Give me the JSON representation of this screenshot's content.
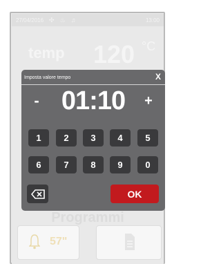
{
  "status_bar": {
    "date": "27/04/2016",
    "time": "13:00",
    "icons": [
      "fan-icon",
      "heating-icon",
      "bell-icon"
    ]
  },
  "main": {
    "temp_label": "temp",
    "temp_value": "120",
    "temp_unit": "°C",
    "program_label": "Programmi",
    "alarm_tile_value": "57\""
  },
  "dialog": {
    "title": "Imposta valore tempo",
    "close_label": "X",
    "minus_label": "-",
    "plus_label": "+",
    "time_value": "01:10",
    "keys": [
      "1",
      "2",
      "3",
      "4",
      "5",
      "6",
      "7",
      "8",
      "9",
      "0"
    ],
    "ok_label": "OK",
    "ok_color": "#c21a1e"
  }
}
